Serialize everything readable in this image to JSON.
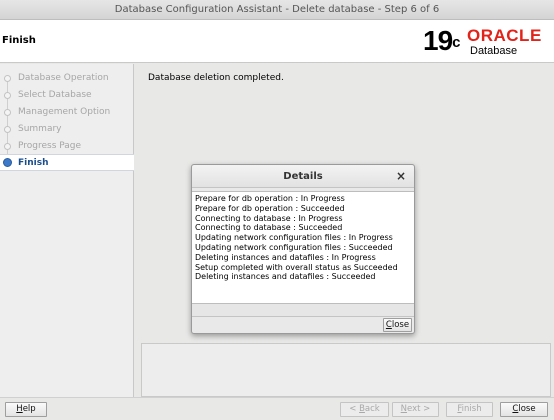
{
  "window": {
    "title": "Database Configuration Assistant - Delete database - Step 6 of 6"
  },
  "header": {
    "title": "Finish",
    "logo": {
      "version": "19",
      "version_suffix": "c",
      "brand": "ORACLE",
      "product": "Database",
      "brand_color": "#e2231a"
    }
  },
  "sidebar": {
    "steps": [
      {
        "label": "Database Operation",
        "state": "completed"
      },
      {
        "label": "Select Database",
        "state": "completed"
      },
      {
        "label": "Management Option",
        "state": "completed"
      },
      {
        "label": "Summary",
        "state": "completed"
      },
      {
        "label": "Progress Page",
        "state": "completed"
      },
      {
        "label": "Finish",
        "state": "active"
      }
    ]
  },
  "main": {
    "status": "Database deletion completed."
  },
  "dialog": {
    "title": "Details",
    "close_glyph": "×",
    "log": [
      "Prepare for db operation : In Progress",
      "Prepare for db operation : Succeeded",
      "Connecting to database : In Progress",
      "Connecting to database : Succeeded",
      "Updating network configuration files : In Progress",
      "Updating network configuration files : Succeeded",
      "Deleting instances and datafiles : In Progress",
      "Setup completed with overall status as Succeeded",
      "Deleting instances and datafiles : Succeeded"
    ],
    "close_button": {
      "label": "Close",
      "mnemonic": "C",
      "rest": "lose"
    }
  },
  "footer": {
    "help": {
      "label": "Help",
      "mnemonic": "H",
      "rest": "elp"
    },
    "back": {
      "label": "< Back",
      "pre": "< ",
      "mnemonic": "B",
      "rest": "ack",
      "enabled": false
    },
    "next": {
      "label": "Next >",
      "mnemonic": "N",
      "rest": "ext >",
      "enabled": false
    },
    "finish": {
      "label": "Finish",
      "mnemonic": "F",
      "rest": "inish",
      "enabled": false
    },
    "close": {
      "label": "Close",
      "mnemonic": "C",
      "rest": "lose",
      "enabled": true
    }
  }
}
